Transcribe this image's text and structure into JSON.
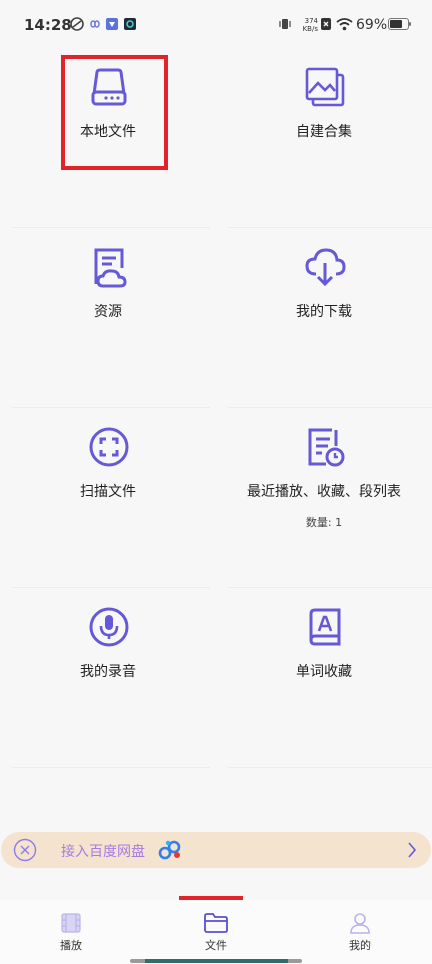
{
  "status_bar": {
    "time": "14:28",
    "net_speed_value": "374",
    "net_speed_unit": "KB/s",
    "battery": "69%"
  },
  "grid": [
    {
      "label": "本地文件",
      "icon": "drive-icon"
    },
    {
      "label": "自建合集",
      "icon": "gallery-icon"
    },
    {
      "label": "资源",
      "icon": "cloud-document-icon"
    },
    {
      "label": "我的下载",
      "icon": "cloud-download-icon"
    },
    {
      "label": "扫描文件",
      "icon": "scan-icon"
    },
    {
      "label": "最近播放、收藏、段列表",
      "icon": "recent-list-icon",
      "sub": "数量: 1"
    },
    {
      "label": "我的录音",
      "icon": "microphone-icon"
    },
    {
      "label": "单词收藏",
      "icon": "word-book-icon"
    }
  ],
  "banner": {
    "text": "接入百度网盘"
  },
  "bottom_nav": {
    "items": [
      {
        "label": "播放",
        "icon": "film-icon"
      },
      {
        "label": "文件",
        "icon": "folder-icon",
        "active": true
      },
      {
        "label": "我的",
        "icon": "person-icon"
      }
    ]
  },
  "colors": {
    "accent": "#6559d6",
    "highlight": "#e2242a",
    "banner_bg": "#f4e3cf",
    "banner_text": "#a77be0"
  }
}
